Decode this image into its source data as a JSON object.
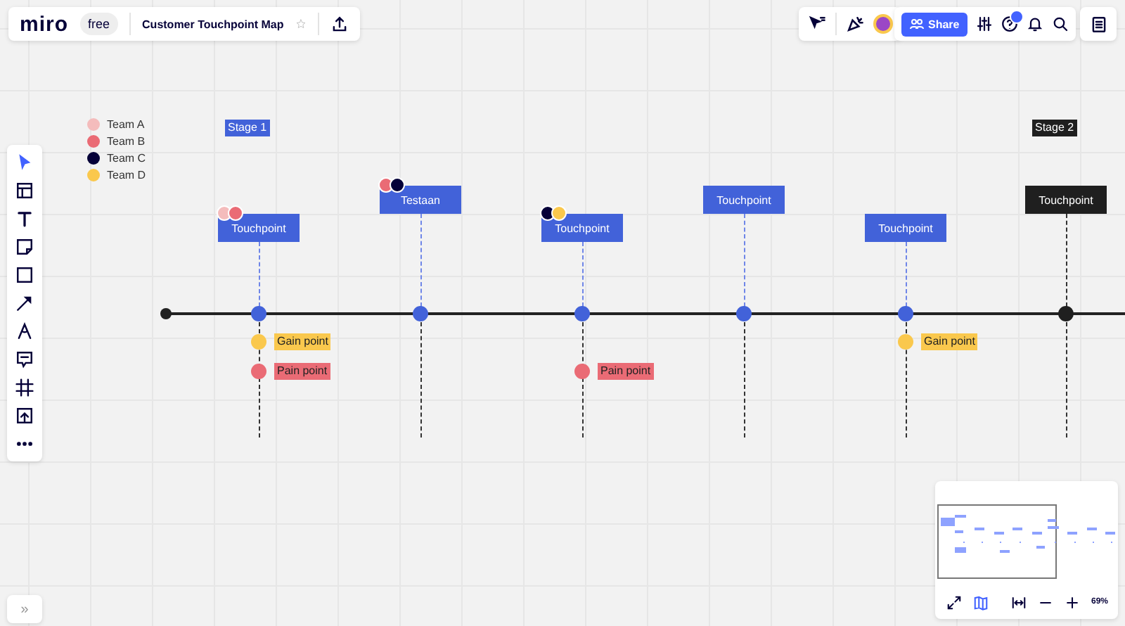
{
  "topbar": {
    "logo": "miro",
    "plan": "free",
    "board_title": "Customer Touchpoint Map",
    "share": "Share"
  },
  "legend": [
    {
      "label": "Team A",
      "color": "#f4bcbc"
    },
    {
      "label": "Team B",
      "color": "#ea6b75"
    },
    {
      "label": "Team C",
      "color": "#050038"
    },
    {
      "label": "Team D",
      "color": "#fac84d"
    }
  ],
  "stages": [
    {
      "label": "Stage 1",
      "kind": "highlight"
    },
    {
      "label": "Stage 2",
      "kind": "dark"
    }
  ],
  "touchpoints": [
    {
      "label": "Touchpoint",
      "color": "#4262d9",
      "dots": [
        {
          "color": "#f4bcbc"
        },
        {
          "color": "#ea6b75"
        }
      ],
      "points": [
        {
          "kind": "gain",
          "label": "Gain point"
        },
        {
          "kind": "pain",
          "label": "Pain point"
        }
      ]
    },
    {
      "label": "Testaan",
      "color": "#4262d9",
      "dots": [
        {
          "color": "#ea6b75"
        },
        {
          "color": "#050038"
        }
      ]
    },
    {
      "label": "Touchpoint",
      "color": "#4262d9",
      "dots": [
        {
          "color": "#050038"
        },
        {
          "color": "#fac84d"
        }
      ],
      "points": [
        {
          "kind": "pain",
          "label": "Pain point"
        }
      ]
    },
    {
      "label": "Touchpoint",
      "color": "#4262d9"
    },
    {
      "label": "Touchpoint",
      "color": "#4262d9",
      "points": [
        {
          "kind": "gain",
          "label": "Gain point"
        }
      ]
    },
    {
      "label": "Touchpoint",
      "color": "#1f1f1f"
    }
  ],
  "minimap": {
    "zoom": "69%"
  },
  "sidebar_toggle": "»"
}
